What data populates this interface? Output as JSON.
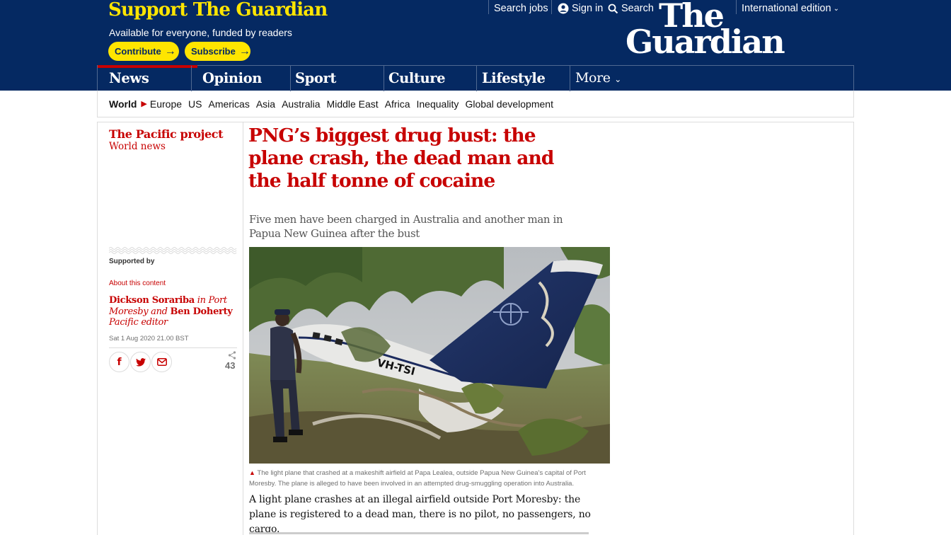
{
  "header": {
    "support_title": "Support The Guardian",
    "support_subtitle": "Available for everyone, funded by readers",
    "contribute_label": "Contribute",
    "subscribe_label": "Subscribe",
    "search_jobs_label": "Search jobs",
    "sign_in_label": "Sign in",
    "search_label": "Search",
    "logo_line1": "The",
    "logo_line2": "Guardian",
    "edition_label": "International edition",
    "colors": {
      "brand_blue": "#052962",
      "support_yellow": "#ffe500",
      "news_red": "#c70000"
    }
  },
  "pillars": [
    {
      "label": "News",
      "active": true
    },
    {
      "label": "Opinion"
    },
    {
      "label": "Sport"
    },
    {
      "label": "Culture"
    },
    {
      "label": "Lifestyle"
    },
    {
      "label": "More"
    }
  ],
  "subnav": {
    "section": "World",
    "items": [
      "Europe",
      "US",
      "Americas",
      "Asia",
      "Australia",
      "Middle East",
      "Africa",
      "Inequality",
      "Global development"
    ]
  },
  "meta": {
    "series": "The Pacific project",
    "section": "World news",
    "supported_by": "Supported by",
    "about_content": "About this content",
    "byline": {
      "author1": "Dickson Sorariba",
      "in1": "in Port Moresby",
      "and": "and",
      "author2": "Ben Doherty",
      "role2": "Pacific editor"
    },
    "date": "Sat 1 Aug 2020 21.00 BST",
    "share_count": "43",
    "share_icons": [
      "facebook-icon",
      "twitter-icon",
      "email-icon",
      "share-icon"
    ]
  },
  "article": {
    "headline": "PNG’s biggest drug bust: the plane crash, the dead man and the half tonne of cocaine",
    "standfirst": "Five men have been charged in Australia and another man in Papua New Guinea after the bust",
    "photo": {
      "tail_registration": "VH-TSI"
    },
    "caption": "The light plane that crashed at a makeshift airfield at Papa Lealea, outside Papua New Guinea’s capital of Port Moresby. The plane is alleged to have been involved in an attempted drug-smuggling operation into Australia.",
    "body_first": "A light plane crashes at an illegal airfield outside Port Moresby: the plane is registered to a dead man, there is no pilot, no passengers, no cargo."
  }
}
